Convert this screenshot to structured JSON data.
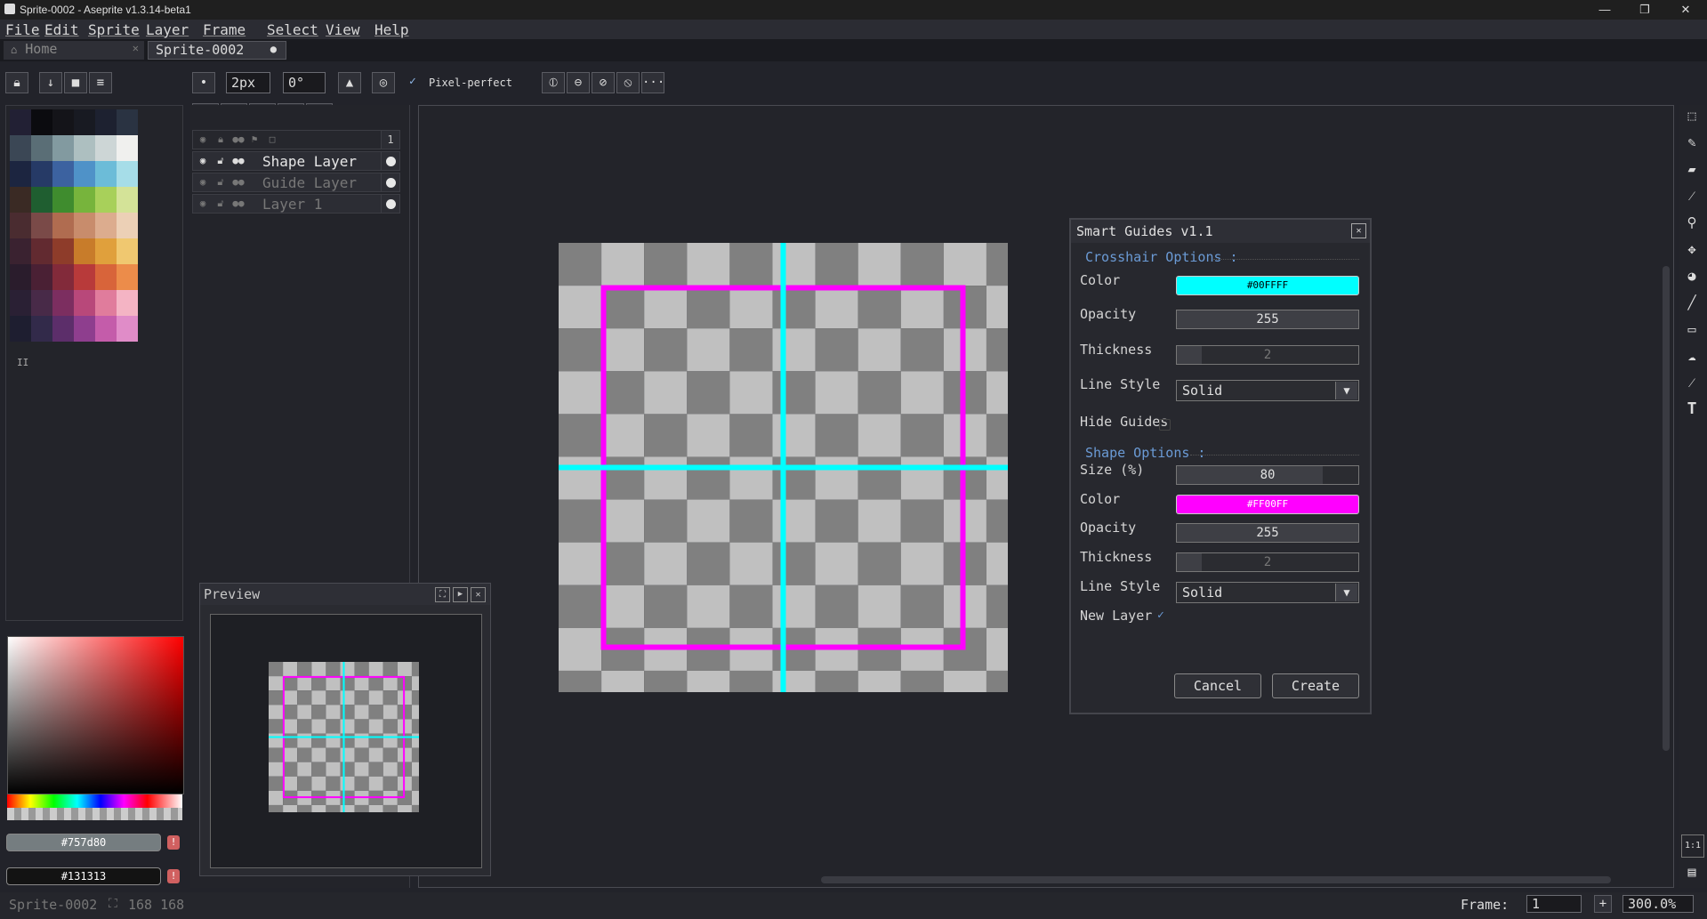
{
  "window": {
    "title": "Sprite-0002 - Aseprite v1.3.14-beta1",
    "minimize": "—",
    "maximize": "❐",
    "close": "✕"
  },
  "menu": [
    "File",
    "Edit",
    "Sprite",
    "Layer",
    "Frame",
    "Select",
    "View",
    "Help"
  ],
  "tabs": {
    "home": "Home",
    "home_close": "✕",
    "active": "Sprite-0002",
    "active_dot": "●"
  },
  "toolbar": {
    "brush_size": "2px",
    "angle": "0°",
    "pixel_perfect_check": "✓",
    "pixel_perfect": "Pixel-perfect",
    "more": "···"
  },
  "palette": {
    "colors": [
      "#222034",
      "#0b0b0f",
      "#141419",
      "#181a22",
      "#1d2130",
      "#2a3342",
      "#3b4755",
      "#5a6e76",
      "#829aa0",
      "#adbfc0",
      "#cdd6d6",
      "#f0f0ee",
      "#1c2540",
      "#263a66",
      "#3c62a0",
      "#4f92c8",
      "#6cbcd8",
      "#a6dde8",
      "#3a2a24",
      "#1f5e30",
      "#3f8c2e",
      "#77b43c",
      "#a8d05a",
      "#d4e398",
      "#4a2c30",
      "#7a4a48",
      "#b06c50",
      "#c88c6c",
      "#dcac8e",
      "#ecd0b6",
      "#3a2230",
      "#622a30",
      "#8e3c2a",
      "#c87c2a",
      "#e0a03c",
      "#f0c870",
      "#2a1c2c",
      "#4a2034",
      "#822a3a",
      "#b83a3a",
      "#d8643a",
      "#ec8c4a",
      "#2a2034",
      "#482a48",
      "#7c2e60",
      "#b8487a",
      "#e07c9c",
      "#f4b4c4",
      "#1e1e30",
      "#322a4a",
      "#5c2e6a",
      "#8e3e8e",
      "#c45caa",
      "#e08cc8"
    ],
    "fg_color": "#757d80",
    "bg_color": "#131313"
  },
  "layers": [
    {
      "name": "Shape Layer",
      "active": true
    },
    {
      "name": "Guide Layer",
      "active": false
    },
    {
      "name": "Layer 1",
      "active": false
    }
  ],
  "timeline": {
    "frame_header": "1"
  },
  "preview": {
    "title": "Preview"
  },
  "dialog": {
    "title": "Smart Guides v1.1",
    "close": "✕",
    "crosshair_section": "Crosshair Options :",
    "crosshair": {
      "color_label": "Color",
      "color": "#00FFFF",
      "opacity_label": "Opacity",
      "opacity": "255",
      "thickness_label": "Thickness",
      "thickness": "2",
      "thickness_fill": 0.14,
      "linestyle_label": "Line Style",
      "linestyle": "Solid",
      "hide_label": "Hide Guides"
    },
    "shape_section": "Shape Options :",
    "shape": {
      "size_label": "Size (%)",
      "size": "80",
      "size_fill": 0.8,
      "color_label": "Color",
      "color": "#FF00FF",
      "opacity_label": "Opacity",
      "opacity": "255",
      "thickness_label": "Thickness",
      "thickness": "2",
      "thickness_fill": 0.14,
      "linestyle_label": "Line Style",
      "linestyle": "Solid",
      "newlayer_label": "New Layer",
      "newlayer_check": "✓"
    },
    "cancel": "Cancel",
    "create": "Create"
  },
  "status": {
    "sprite": "Sprite-0002",
    "size": "168 168",
    "frame_label": "Frame:",
    "frame": "1",
    "plus": "+",
    "zoom": "300.0%"
  },
  "colors": {
    "crosshair": "#00ffff",
    "shape": "#ff00ff",
    "checker_dark": "#808080",
    "checker_light": "#c0c0c0"
  }
}
